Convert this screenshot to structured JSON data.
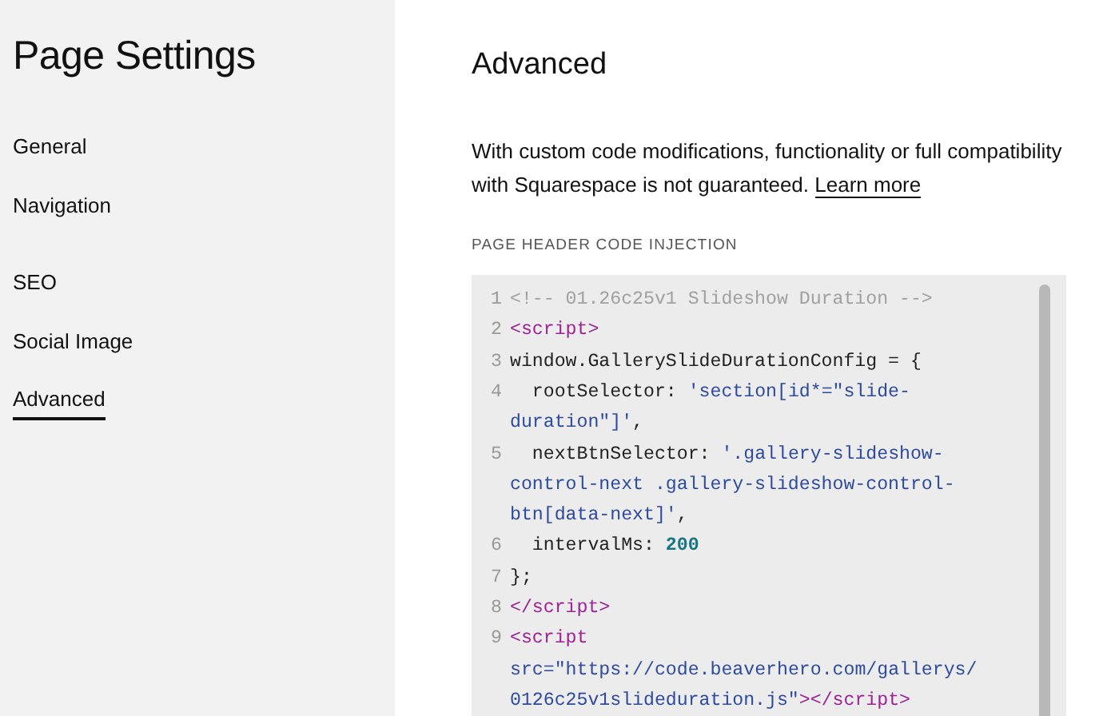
{
  "sidebar": {
    "title": "Page Settings",
    "groups": [
      {
        "items": [
          {
            "label": "General",
            "selected": false
          },
          {
            "label": "Navigation",
            "selected": false
          }
        ]
      },
      {
        "items": [
          {
            "label": "SEO",
            "selected": false
          },
          {
            "label": "Social Image",
            "selected": false
          },
          {
            "label": "Advanced",
            "selected": true
          }
        ]
      }
    ]
  },
  "main": {
    "title": "Advanced",
    "description": "With custom code modifications, functionality or full compatibility with Squarespace is not guaranteed.",
    "link": "Learn more",
    "section_label": "PAGE HEADER CODE INJECTION",
    "code_lines": [
      {
        "number": "1",
        "tokens": [
          {
            "kind": "comment",
            "text": "<!-- 01.26c25v1 Slideshow Duration -->"
          }
        ]
      },
      {
        "number": "2",
        "tokens": [
          {
            "kind": "tag",
            "text": "<script>"
          }
        ]
      },
      {
        "number": "3",
        "tokens": [
          {
            "kind": "plain",
            "text": "window.GallerySlideDurationConfig = {"
          }
        ]
      },
      {
        "number": "4",
        "tokens": [
          {
            "kind": "plain",
            "text": "  rootSelector: "
          },
          {
            "kind": "string",
            "text": "'section[id*=\"slide-duration\"]'"
          },
          {
            "kind": "plain",
            "text": ","
          }
        ]
      },
      {
        "number": "5",
        "tokens": [
          {
            "kind": "plain",
            "text": "  nextBtnSelector: "
          },
          {
            "kind": "string",
            "text": "'.gallery-slideshow-control-next .gallery-slideshow-control-btn[data-next]'"
          },
          {
            "kind": "plain",
            "text": ","
          }
        ]
      },
      {
        "number": "6",
        "tokens": [
          {
            "kind": "plain",
            "text": "  intervalMs: "
          },
          {
            "kind": "number",
            "text": "200"
          }
        ]
      },
      {
        "number": "7",
        "tokens": [
          {
            "kind": "plain",
            "text": "};"
          }
        ]
      },
      {
        "number": "8",
        "tokens": [
          {
            "kind": "tag",
            "text": "</script>"
          }
        ]
      },
      {
        "number": "9",
        "tokens": [
          {
            "kind": "tag",
            "text": "<script"
          },
          {
            "kind": "attr",
            "text": " src="
          },
          {
            "kind": "string",
            "text": "\"https://code.beaverhero.com/gallerys/"
          },
          {
            "kind": "string",
            "text": "0126c25v1slideduration.js\""
          },
          {
            "kind": "tag",
            "text": "></script>"
          }
        ]
      }
    ]
  }
}
